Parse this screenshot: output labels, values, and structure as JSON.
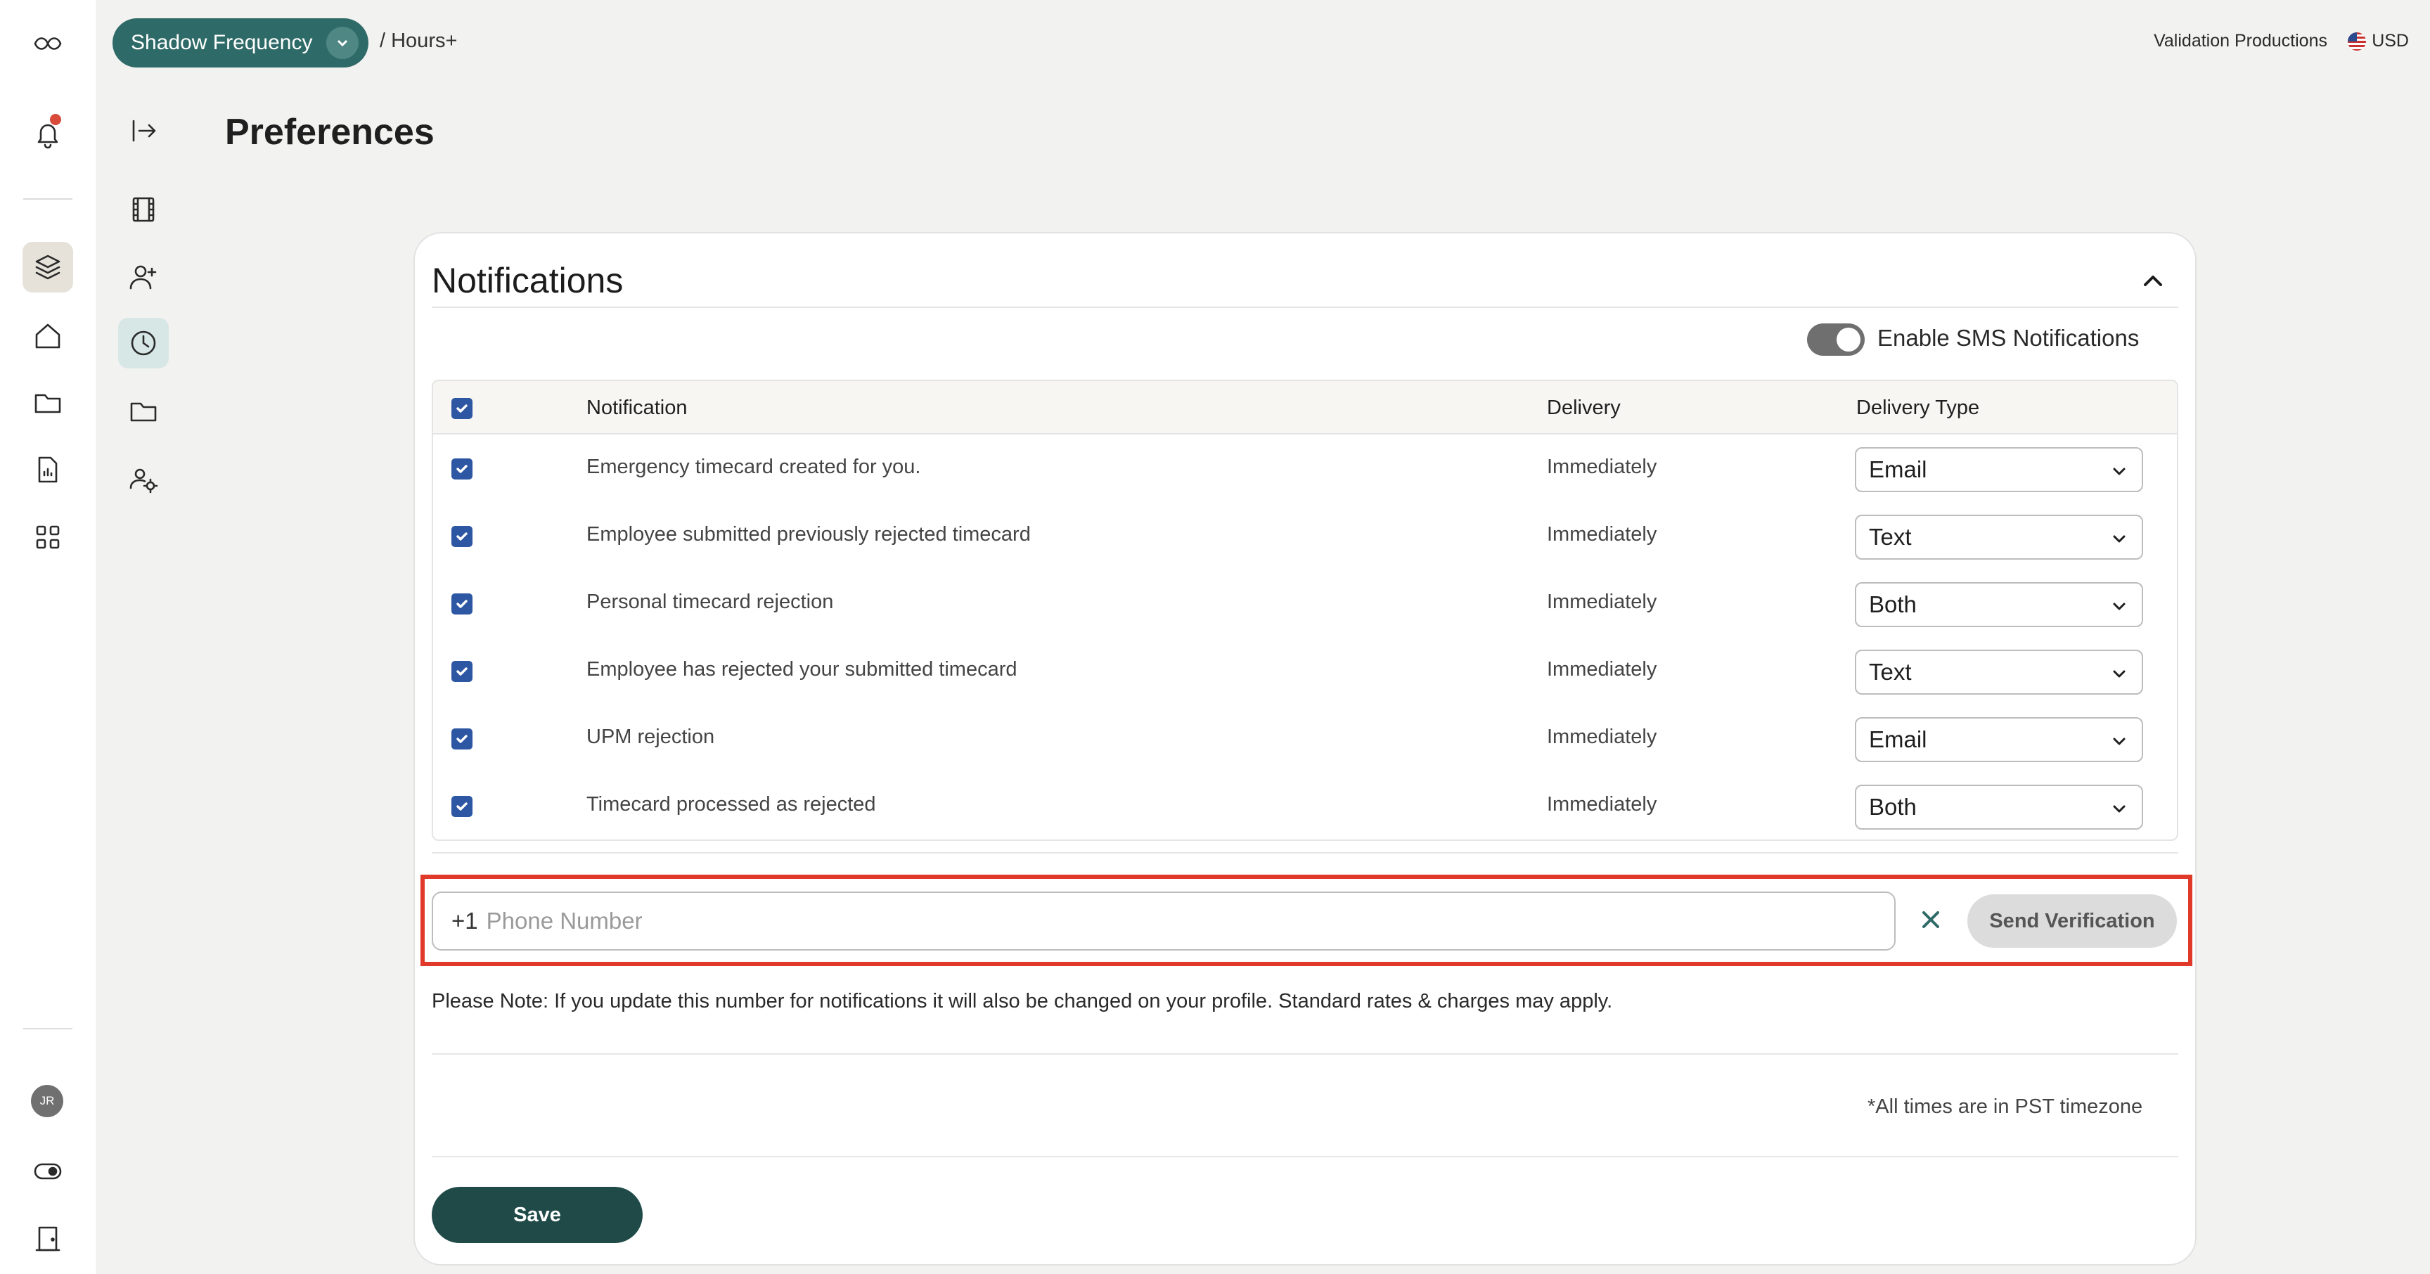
{
  "header": {
    "project_name": "Shadow Frequency",
    "breadcrumb": "/ Hours+",
    "company": "Validation Productions",
    "currency": "USD"
  },
  "user": {
    "initials": "JR"
  },
  "page": {
    "title": "Preferences"
  },
  "notifications": {
    "title": "Notifications",
    "sms_toggle_label": "Enable SMS Notifications",
    "sms_enabled": true,
    "columns": [
      "Notification",
      "Delivery",
      "Delivery Type"
    ],
    "rows": [
      {
        "notification": "Emergency timecard created for you.",
        "delivery": "Immediately",
        "delivery_type": "Email",
        "checked": true
      },
      {
        "notification": "Employee submitted previously rejected timecard",
        "delivery": "Immediately",
        "delivery_type": "Text",
        "checked": true
      },
      {
        "notification": "Personal timecard rejection",
        "delivery": "Immediately",
        "delivery_type": "Both",
        "checked": true
      },
      {
        "notification": "Employee has rejected your submitted timecard",
        "delivery": "Immediately",
        "delivery_type": "Text",
        "checked": true
      },
      {
        "notification": "UPM rejection",
        "delivery": "Immediately",
        "delivery_type": "Email",
        "checked": true
      },
      {
        "notification": "Timecard processed as rejected",
        "delivery": "Immediately",
        "delivery_type": "Both",
        "checked": true
      }
    ],
    "phone": {
      "prefix": "+1",
      "placeholder": "Phone Number",
      "value": "",
      "send_label": "Send Verification"
    },
    "note": "Please Note: If you update this number for notifications it will also be changed on your profile. Standard rates & charges may apply.",
    "timezone_note": "*All times are in PST timezone",
    "save_label": "Save"
  },
  "colors": {
    "brand": "#2e6a67",
    "save_button": "#1f4a48",
    "checkbox": "#2d56a3",
    "highlight": "#e0392a",
    "notification_dot": "#d84a3a"
  },
  "icons": {
    "rail": [
      "logo-icon",
      "bell-icon",
      "layers-icon",
      "home-icon",
      "folder-icon",
      "report-icon",
      "apps-icon",
      "avatar",
      "toggle-icon",
      "door-icon"
    ],
    "subrail": [
      "expand-icon",
      "film-icon",
      "add-user-icon",
      "clock-icon",
      "folder-icon",
      "team-settings-icon"
    ]
  }
}
